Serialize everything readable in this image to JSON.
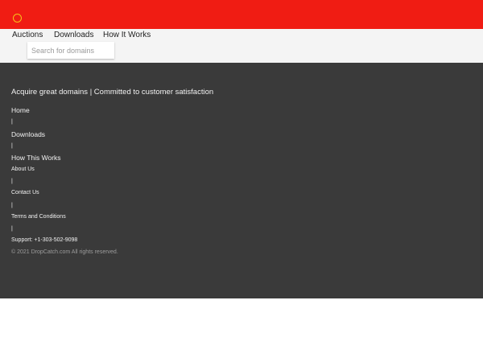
{
  "header": {
    "logo_icon": "circle-ring-icon",
    "colors": {
      "bar": "#f01c13",
      "ring": "#f6c21a"
    }
  },
  "nav": {
    "links": [
      "Auctions",
      "Downloads",
      "How It Works"
    ],
    "search": {
      "placeholder": "Search for domains",
      "value": ""
    }
  },
  "footer": {
    "tagline": "Acquire great domains | Committed to customer satisfaction",
    "primary_links": [
      "Home",
      "Downloads",
      "How This Works"
    ],
    "secondary_links": [
      "About Us",
      "Contact Us",
      "Terms and Conditions"
    ],
    "separator": "|",
    "support": "Support: +1-303-502-9098",
    "copyright": "© 2021 DropCatch.com All rights reserved.",
    "colors": {
      "background": "#3a3a3a"
    }
  }
}
